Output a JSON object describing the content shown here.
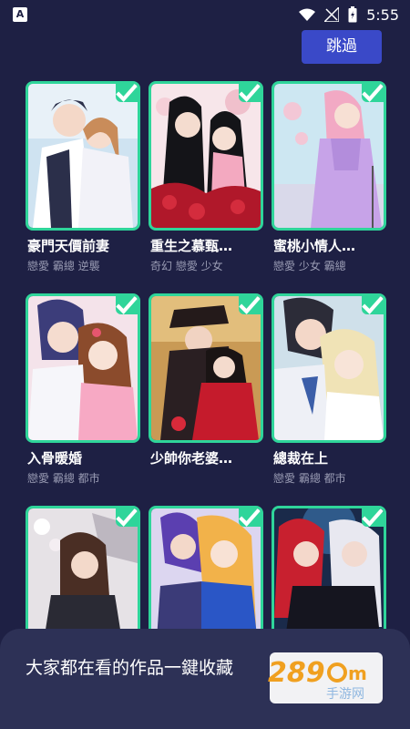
{
  "status_bar": {
    "time": "5:55",
    "left_icon": "A",
    "icons": [
      "wifi-icon",
      "signal-icon",
      "battery-icon"
    ]
  },
  "skip_label": "跳過",
  "books": [
    {
      "title": "豪門天價前妻",
      "tags": "戀愛 霸總 逆襲",
      "selected": true
    },
    {
      "title": "重生之慕甄…",
      "tags": "奇幻 戀愛 少女",
      "selected": true
    },
    {
      "title": "蜜桃小情人…",
      "tags": "戀愛 少女 霸總",
      "selected": true
    },
    {
      "title": "入骨暖婚",
      "tags": "戀愛 霸總 都市",
      "selected": true
    },
    {
      "title": "少帥你老婆…",
      "tags": "",
      "selected": true
    },
    {
      "title": "總裁在上",
      "tags": "戀愛 霸總 都市",
      "selected": true
    },
    {
      "title": "",
      "tags": "",
      "selected": true
    },
    {
      "title": "",
      "tags": "",
      "selected": true
    },
    {
      "title": "",
      "tags": "",
      "selected": true
    }
  ],
  "bottom_sheet": {
    "text": "大家都在看的作品一鍵收藏"
  },
  "watermark": "289手游网",
  "colors": {
    "background": "#1e2044",
    "accent_green": "#2fd59a",
    "skip_button": "#3a49c8",
    "sheet": "#2d3156"
  }
}
